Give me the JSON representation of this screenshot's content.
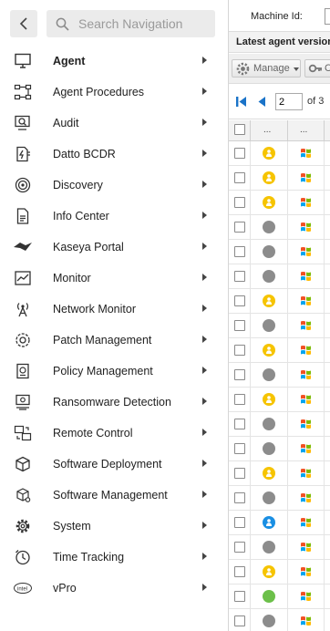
{
  "search": {
    "placeholder": "Search Navigation"
  },
  "nav": [
    {
      "label": "Agent",
      "icon": "monitor-icon",
      "active": true
    },
    {
      "label": "Agent Procedures",
      "icon": "procedure-flow-icon"
    },
    {
      "label": "Audit",
      "icon": "audit-magnifier-icon"
    },
    {
      "label": "Datto BCDR",
      "icon": "bcdr-bolt-icon"
    },
    {
      "label": "Discovery",
      "icon": "discovery-radar-icon"
    },
    {
      "label": "Info Center",
      "icon": "info-document-icon"
    },
    {
      "label": "Kaseya Portal",
      "icon": "kaseya-portal-icon"
    },
    {
      "label": "Monitor",
      "icon": "monitor-chart-icon"
    },
    {
      "label": "Network Monitor",
      "icon": "network-antenna-icon"
    },
    {
      "label": "Patch Management",
      "icon": "patch-gear-icon"
    },
    {
      "label": "Policy Management",
      "icon": "policy-scroll-icon"
    },
    {
      "label": "Ransomware Detection",
      "icon": "ransomware-shield-icon"
    },
    {
      "label": "Remote Control",
      "icon": "remote-control-icon"
    },
    {
      "label": "Software Deployment",
      "icon": "package-box-icon"
    },
    {
      "label": "Software Management",
      "icon": "software-cube-icon"
    },
    {
      "label": "System",
      "icon": "system-gear-icon"
    },
    {
      "label": "Time Tracking",
      "icon": "clock-icon"
    },
    {
      "label": "vPro",
      "icon": "intel-vpro-icon"
    }
  ],
  "panel": {
    "machine_label": "Machine Id:",
    "section_title": "Latest agent version",
    "toolbar": {
      "manage_label": "Manage",
      "second_label": "C"
    },
    "pager": {
      "page": "2",
      "of_text": "of 3"
    },
    "grid": {
      "headers": [
        "...",
        "..."
      ],
      "rows": [
        {
          "status": "yellow"
        },
        {
          "status": "yellow"
        },
        {
          "status": "yellow"
        },
        {
          "status": "gray"
        },
        {
          "status": "gray"
        },
        {
          "status": "gray"
        },
        {
          "status": "yellow"
        },
        {
          "status": "gray"
        },
        {
          "status": "yellow"
        },
        {
          "status": "gray"
        },
        {
          "status": "yellow"
        },
        {
          "status": "gray"
        },
        {
          "status": "gray"
        },
        {
          "status": "yellow"
        },
        {
          "status": "gray"
        },
        {
          "status": "blue"
        },
        {
          "status": "gray"
        },
        {
          "status": "yellow"
        },
        {
          "status": "green"
        },
        {
          "status": "gray"
        }
      ]
    }
  },
  "colors": {
    "status_yellow": "#f6c400",
    "status_gray": "#8c8c8c",
    "status_green": "#6cc04a",
    "status_blue": "#1a8fe3",
    "pager_blue": "#1a73c8"
  }
}
